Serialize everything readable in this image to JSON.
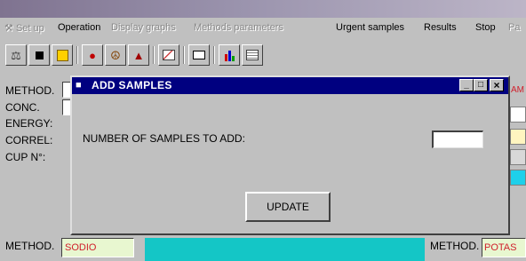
{
  "window": {
    "title": ""
  },
  "menu": [
    {
      "label": "Set up",
      "disabled": true
    },
    {
      "label": "Operation",
      "disabled": false
    },
    {
      "label": "Display graphs",
      "disabled": true
    },
    {
      "label": "Methods parameters",
      "disabled": true
    },
    {
      "label": "Urgent samples",
      "disabled": false
    },
    {
      "label": "Results",
      "disabled": false
    },
    {
      "label": "Stop",
      "disabled": false
    },
    {
      "label": "Pa",
      "disabled": true
    }
  ],
  "toolbar": {
    "buttons": [
      "chemistry-icon",
      "stop-square-icon",
      "list-grid-icon",
      "traffic-light-icon",
      "tubes-icon",
      "rack-icon",
      "chart-icon",
      "print-icon",
      "bar-chart-icon",
      "notes-icon"
    ]
  },
  "panel": {
    "labels": {
      "method": "METHOD.",
      "conc": "CONC.",
      "energy": "ENERGY:",
      "correl": "CORREL:",
      "cup": "CUP N°:"
    },
    "bottom_left_method_label": "METHOD.",
    "bottom_left_method_value": "SODIO",
    "bottom_right_method_label": "METHOD.",
    "bottom_right_method_value": "POTAS",
    "right_cut_text": "AM"
  },
  "dialog": {
    "title": "ADD SAMPLES",
    "prompt": "NUMBER OF SAMPLES TO ADD:",
    "input_value": "",
    "update_label": "UPDATE",
    "minimize_glyph": "_",
    "maximize_glyph": "□",
    "close_glyph": "×"
  },
  "colors": {
    "title_active": "#000080",
    "method_value_bg": "#e8f7d0",
    "teal_fill": "#14c6c6",
    "method_text": "#d0202c",
    "yellow_field": "#fff5c0",
    "cyan_field": "#1ed0ea"
  }
}
